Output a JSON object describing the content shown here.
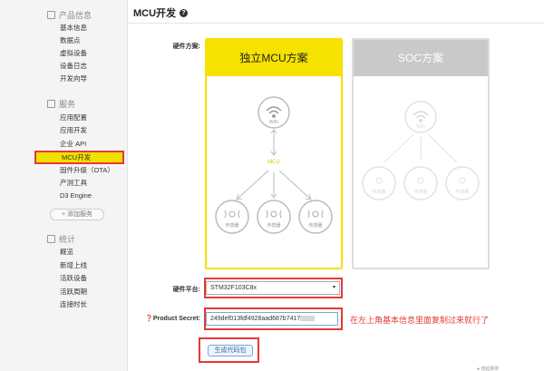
{
  "sidebar": {
    "sections": [
      {
        "title": "产品信息",
        "items": [
          "基本信息",
          "数据点",
          "虚拟设备",
          "设备日志",
          "开发向导"
        ]
      },
      {
        "title": "服务",
        "items": [
          "应用配置",
          "应用开发",
          "企业 API",
          "MCU开发",
          "固件升级（OTA）",
          "产测工具",
          "D3 Engine"
        ]
      },
      {
        "title": "统计",
        "items": [
          "概览",
          "新增上线",
          "活跃设备",
          "活跃周期",
          "连接时长"
        ]
      }
    ],
    "add_service_label": "+ 添加服务",
    "active_item": "MCU开发"
  },
  "main": {
    "title": "MCU开发",
    "help_glyph": "?",
    "hardware_scheme_label": "硬件方案:",
    "cards": [
      {
        "title": "独立MCU方案",
        "selected": true,
        "wifi_label": "WiFi",
        "mcu_label": "MCU",
        "sensor_label": "传感器"
      },
      {
        "title": "SOC方案",
        "selected": false,
        "wifi_label": "WiFi",
        "sensor_label": "传感器"
      }
    ],
    "platform_label": "硬件平台:",
    "platform_value": "STM32F103C8x",
    "secret_label": "Product Secret:",
    "secret_value": "249def013fdf4928aad687b7417",
    "hint": "在左上角基本信息里面复制过来就行了",
    "generate_label": "生成代码包"
  },
  "footer": {
    "text": "● 收起菜单"
  },
  "colors": {
    "accent": "#f5e200",
    "highlight": "#e53935",
    "link": "#3b6aa6"
  }
}
